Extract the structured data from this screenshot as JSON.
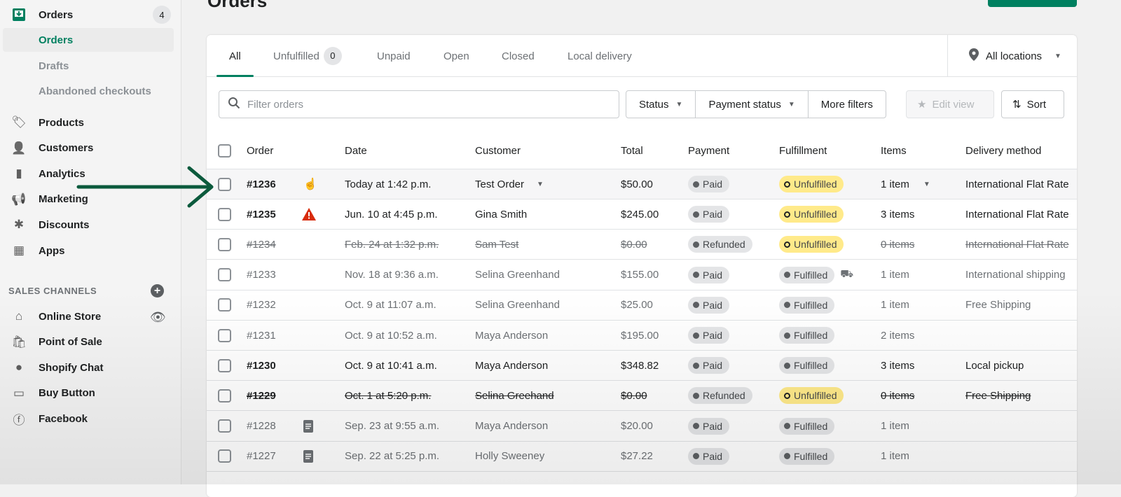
{
  "page": {
    "title": "Orders"
  },
  "sidebar": {
    "orders": {
      "label": "Orders",
      "badge": "4"
    },
    "sub_items": [
      {
        "label": "Orders",
        "active": true
      },
      {
        "label": "Drafts"
      },
      {
        "label": "Abandoned checkouts"
      }
    ],
    "items": [
      {
        "label": "Products",
        "icon": "tag-icon"
      },
      {
        "label": "Customers",
        "icon": "person-icon"
      },
      {
        "label": "Analytics",
        "icon": "bar-chart-icon"
      },
      {
        "label": "Marketing",
        "icon": "megaphone-icon"
      },
      {
        "label": "Discounts",
        "icon": "discount-icon"
      },
      {
        "label": "Apps",
        "icon": "apps-icon"
      }
    ],
    "sales_channels_label": "SALES CHANNELS",
    "channels": [
      {
        "label": "Online Store",
        "icon": "store-icon"
      },
      {
        "label": "Point of Sale",
        "icon": "shopping-bag-icon"
      },
      {
        "label": "Shopify Chat",
        "icon": "chat-icon"
      },
      {
        "label": "Buy Button",
        "icon": "buy-button-icon"
      },
      {
        "label": "Facebook",
        "icon": "facebook-icon"
      }
    ]
  },
  "tabs": [
    {
      "label": "All",
      "active": true
    },
    {
      "label": "Unfulfilled",
      "count": "0"
    },
    {
      "label": "Unpaid"
    },
    {
      "label": "Open"
    },
    {
      "label": "Closed"
    },
    {
      "label": "Local delivery"
    }
  ],
  "location": {
    "label": "All locations"
  },
  "filters": {
    "search_placeholder": "Filter orders",
    "search_value": "",
    "status": "Status",
    "payment_status": "Payment status",
    "more": "More filters",
    "edit_view": "Edit view",
    "sort": "Sort"
  },
  "table": {
    "headers": {
      "order": "Order",
      "date": "Date",
      "customer": "Customer",
      "total": "Total",
      "payment": "Payment",
      "fulfillment": "Fulfillment",
      "items": "Items",
      "delivery": "Delivery method"
    },
    "rows": [
      {
        "order": "#1236",
        "date": "Today at 1:42 p.m.",
        "customer": "Test Order",
        "total": "$50.00",
        "payment": "Paid",
        "fulfillment": "Unfulfilled",
        "items": "1 item",
        "delivery": "International Flat Rate",
        "style": "bold hover",
        "customer_dropdown": true,
        "items_dropdown": true,
        "icon": "cursor"
      },
      {
        "order": "#1235",
        "date": "Jun. 10 at 4:45 p.m.",
        "customer": "Gina Smith",
        "total": "$245.00",
        "payment": "Paid",
        "fulfillment": "Unfulfilled",
        "items": "3 items",
        "delivery": "International Flat Rate",
        "style": "bold",
        "icon": "warning"
      },
      {
        "order": "#1234",
        "date": "Feb. 24 at 1:32 p.m.",
        "customer": "Sam Test",
        "total": "$0.00",
        "payment": "Refunded",
        "fulfillment": "Unfulfilled",
        "items": "0 items",
        "delivery": "International Flat Rate",
        "style": "muted strike"
      },
      {
        "order": "#1233",
        "date": "Nov. 18 at 9:36 a.m.",
        "customer": "Selina Greenhand",
        "total": "$155.00",
        "payment": "Paid",
        "fulfillment": "Fulfilled",
        "items": "1 item",
        "delivery": "International shipping",
        "style": "muted",
        "truck": true
      },
      {
        "order": "#1232",
        "date": "Oct. 9 at 11:07 a.m.",
        "customer": "Selina Greenhand",
        "total": "$25.00",
        "payment": "Paid",
        "fulfillment": "Fulfilled",
        "items": "1 item",
        "delivery": "Free Shipping",
        "style": "muted"
      },
      {
        "order": "#1231",
        "date": "Oct. 9 at 10:52 a.m.",
        "customer": "Maya Anderson",
        "total": "$195.00",
        "payment": "Paid",
        "fulfillment": "Fulfilled",
        "items": "2 items",
        "delivery": "",
        "style": "muted"
      },
      {
        "order": "#1230",
        "date": "Oct. 9 at 10:41 a.m.",
        "customer": "Maya Anderson",
        "total": "$348.82",
        "payment": "Paid",
        "fulfillment": "Fulfilled",
        "items": "3 items",
        "delivery": "Local pickup",
        "style": "bold"
      },
      {
        "order": "#1229",
        "date": "Oct. 1 at 5:20 p.m.",
        "customer": "Selina Greehand",
        "total": "$0.00",
        "payment": "Refunded",
        "fulfillment": "Unfulfilled",
        "items": "0 items",
        "delivery": "Free Shipping",
        "style": "bold strike"
      },
      {
        "order": "#1228",
        "date": "Sep. 23 at 9:55 a.m.",
        "customer": "Maya Anderson",
        "total": "$20.00",
        "payment": "Paid",
        "fulfillment": "Fulfilled",
        "items": "1 item",
        "delivery": "",
        "style": "muted",
        "icon": "note"
      },
      {
        "order": "#1227",
        "date": "Sep. 22 at 5:25 p.m.",
        "customer": "Holly Sweeney",
        "total": "$27.22",
        "payment": "Paid",
        "fulfillment": "Fulfilled",
        "items": "1 item",
        "delivery": "",
        "style": "muted",
        "icon": "note"
      }
    ]
  },
  "colors": {
    "accent": "#008060",
    "arrow": "#0b5a3c",
    "warning_badge": "#ffea8a",
    "danger": "#d82c0d"
  }
}
